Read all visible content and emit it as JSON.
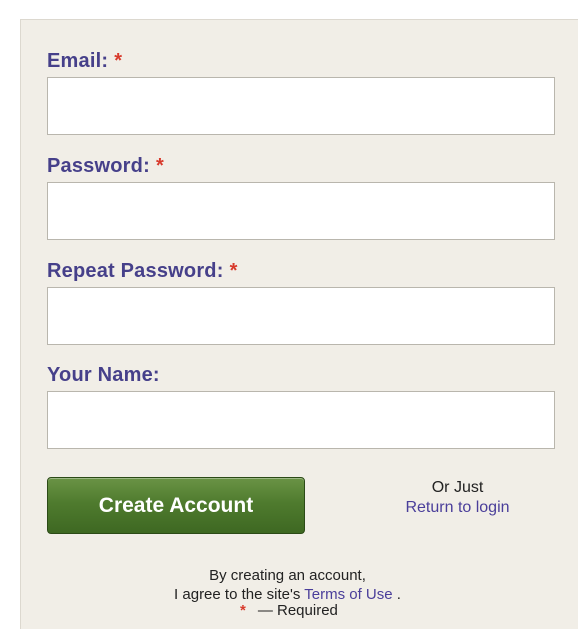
{
  "form": {
    "email": {
      "label": "Email:",
      "required_mark": "*",
      "value": "",
      "placeholder": ""
    },
    "password": {
      "label": "Password:",
      "required_mark": "*",
      "value": "",
      "placeholder": ""
    },
    "repeat_password": {
      "label": "Repeat Password:",
      "required_mark": "*",
      "value": "",
      "placeholder": ""
    },
    "your_name": {
      "label": "Your Name:",
      "value": "",
      "placeholder": ""
    }
  },
  "actions": {
    "create_account_label": "Create Account",
    "or_just": "Or Just",
    "return_to_login": "Return to login"
  },
  "agreement": {
    "line1": "By creating an account,",
    "line2_prefix": "I agree to the site's",
    "terms_link": "Terms of Use",
    "line2_suffix": "."
  },
  "legend": {
    "star": "*",
    "text": "— Required"
  },
  "colors": {
    "label": "#46408a",
    "required_star": "#d83a2c",
    "button_green": "#4f7b2e",
    "link": "#4a3e9a",
    "panel_bg": "#f1eee7"
  }
}
